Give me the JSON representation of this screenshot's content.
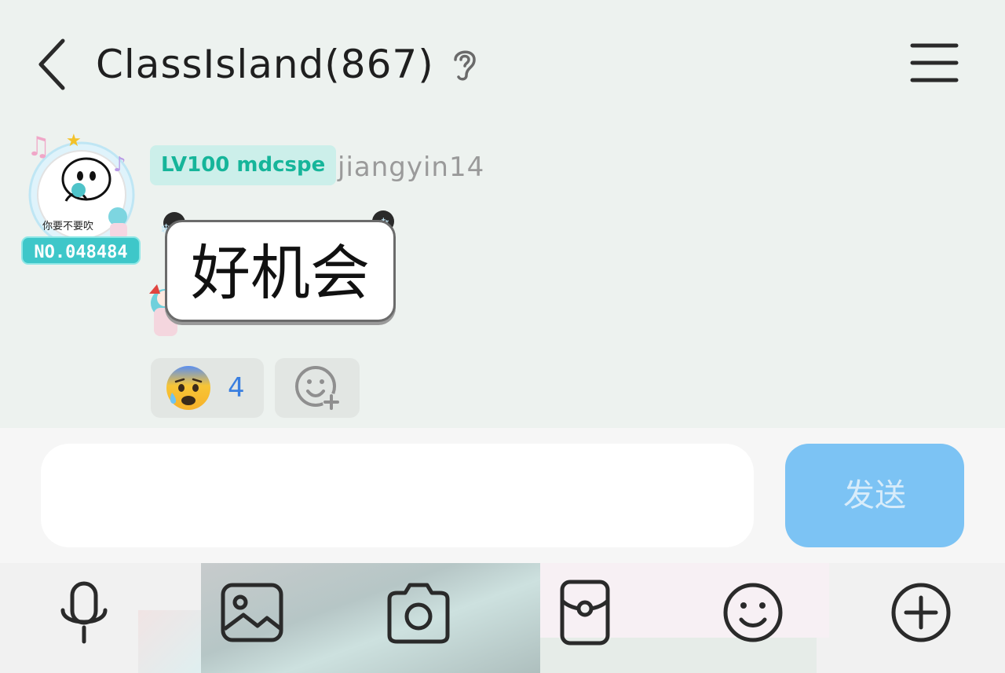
{
  "header": {
    "title": "ClassIsland(867)"
  },
  "message": {
    "avatar_badge_text": "NO.048484",
    "avatar_caption": "你要不要吹",
    "tag": "LV100 mdcspe",
    "sender": "jiangyin14",
    "text": "好机会",
    "reaction": {
      "emoji": "anxious-face-with-sweat",
      "count": "4"
    }
  },
  "composer": {
    "input_value": "",
    "send_label": "发送"
  },
  "toolbar": {
    "icons": [
      "microphone-icon",
      "image-icon",
      "camera-icon",
      "red-packet-icon",
      "emoji-icon",
      "plus-icon"
    ]
  },
  "colors": {
    "background": "#edf2ef",
    "tag_bg": "#ccefea",
    "tag_text": "#16b59a",
    "send_bg": "#7cc3f4",
    "reaction_count": "#3a7fe0"
  }
}
